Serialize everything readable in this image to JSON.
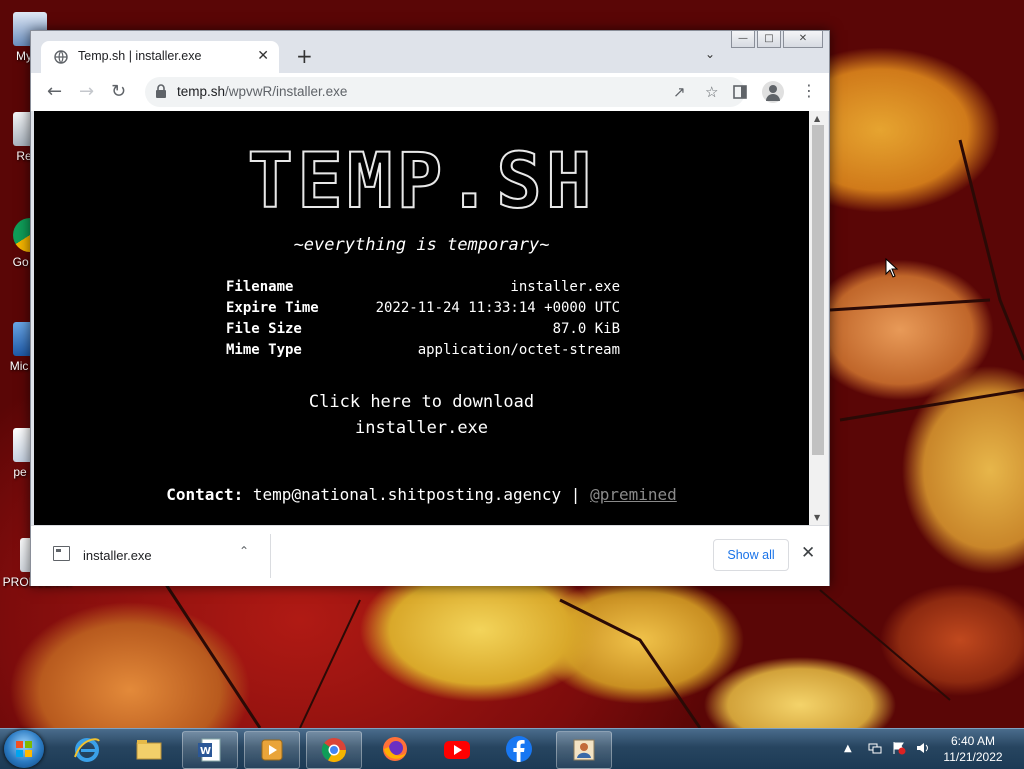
{
  "desktop": {
    "icons": [
      {
        "label": "My C"
      },
      {
        "label": "Recy"
      },
      {
        "label": "Go Ch"
      },
      {
        "label": "Mic Offi"
      },
      {
        "label": "pe pot"
      },
      {
        "label": "PROBLEMM"
      }
    ]
  },
  "browser": {
    "tab": {
      "title": "Temp.sh | installer.exe"
    },
    "new_tab": "+",
    "address": {
      "host": "temp.sh",
      "path": "/wpvwR/installer.exe"
    }
  },
  "page": {
    "logo": "TEMP.SH",
    "tagline": "~everything is temporary~",
    "info": [
      {
        "key": "Filename",
        "value": "installer.exe"
      },
      {
        "key": "Expire Time",
        "value": "2022-11-24 11:33:14 +0000 UTC"
      },
      {
        "key": "File Size",
        "value": "87.0 KiB"
      },
      {
        "key": "Mime Type",
        "value": "application/octet-stream"
      }
    ],
    "download_line1": "Click here to download",
    "download_line2": "installer.exe",
    "contact_label": "Contact:",
    "contact_email": "temp@national.shitposting.agency",
    "contact_sep": "|",
    "contact_handle": "@premined"
  },
  "download_shelf": {
    "filename": "installer.exe",
    "show_all": "Show all"
  },
  "taskbar": {
    "time": "6:40 AM",
    "date": "11/21/2022"
  }
}
